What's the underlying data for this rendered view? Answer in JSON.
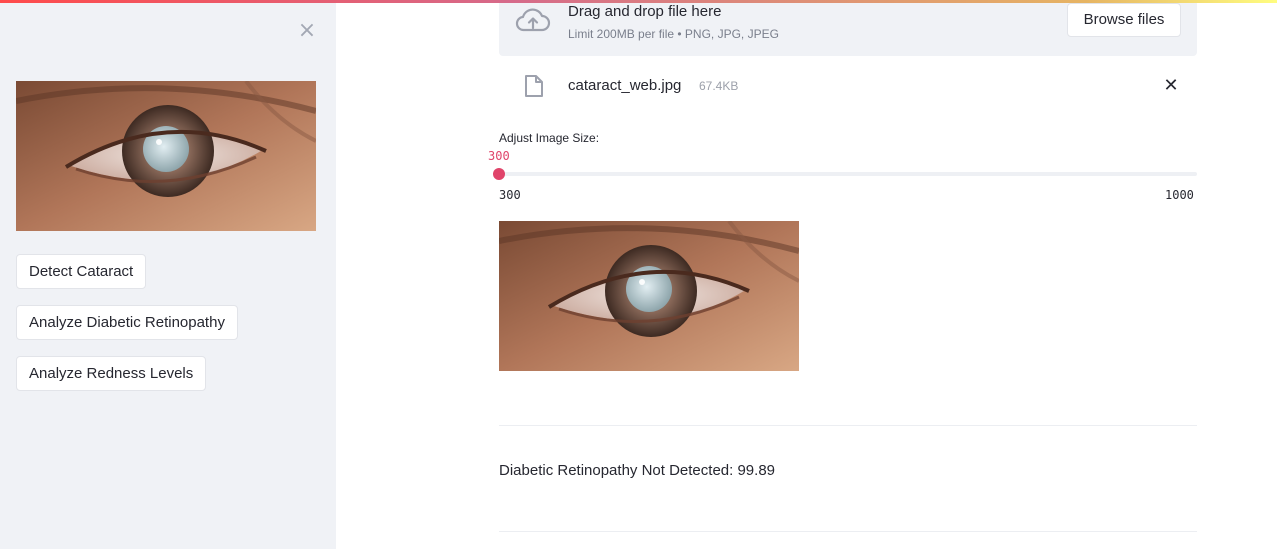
{
  "sidebar": {
    "close_icon": "close-x-icon",
    "image_description_icon": "eye-photo",
    "buttons": [
      {
        "label": "Detect Cataract"
      },
      {
        "label": "Analyze Diabetic Retinopathy"
      },
      {
        "label": "Analyze Redness Levels"
      }
    ]
  },
  "uploader": {
    "icon": "cloud-upload-icon",
    "title": "Drag and drop file here",
    "limit": "Limit 200MB per file • PNG, JPG, JPEG",
    "browse_label": "Browse files"
  },
  "file": {
    "icon": "file-icon",
    "name": "cataract_web.jpg",
    "size": "67.4KB",
    "remove_icon": "close-icon"
  },
  "slider": {
    "label": "Adjust Image Size:",
    "value": 300,
    "value_label": "300",
    "min": 300,
    "max": 1000,
    "min_label": "300",
    "max_label": "1000"
  },
  "result": {
    "text": "Diabetic Retinopathy Not Detected: 99.89"
  },
  "colors": {
    "accent": "#e0446a",
    "sidebar_bg": "#f0f2f6",
    "text": "#262730"
  }
}
